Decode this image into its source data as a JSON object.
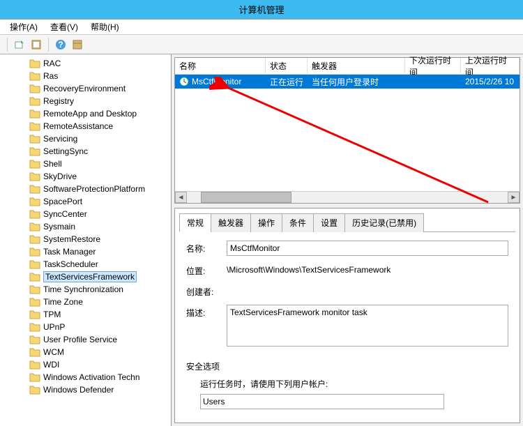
{
  "window": {
    "title": "计算机管理"
  },
  "menu": {
    "action": "操作(A)",
    "view": "查看(V)",
    "help": "帮助(H)"
  },
  "tree": {
    "items": [
      "RAC",
      "Ras",
      "RecoveryEnvironment",
      "Registry",
      "RemoteApp and Desktop",
      "RemoteAssistance",
      "Servicing",
      "SettingSync",
      "Shell",
      "SkyDrive",
      "SoftwareProtectionPlatform",
      "SpacePort",
      "SyncCenter",
      "Sysmain",
      "SystemRestore",
      "Task Manager",
      "TaskScheduler",
      "TextServicesFramework",
      "Time Synchronization",
      "Time Zone",
      "TPM",
      "UPnP",
      "User Profile Service",
      "WCM",
      "WDI",
      "Windows Activation Techn",
      "Windows Defender"
    ],
    "selected_index": 17
  },
  "task_list": {
    "headers": {
      "name": "名称",
      "status": "状态",
      "trigger": "触发器",
      "next_run": "下次运行时间",
      "last_run": "上次运行时间"
    },
    "row": {
      "name": "MsCtfMonitor",
      "status": "正在运行",
      "trigger": "当任何用户登录时",
      "next_run": "",
      "last_run": "2015/2/26 10"
    }
  },
  "tabs": {
    "general": "常规",
    "triggers": "触发器",
    "actions": "操作",
    "conditions": "条件",
    "settings": "设置",
    "history": "历史记录(已禁用)"
  },
  "details": {
    "labels": {
      "name": "名称:",
      "location": "位置:",
      "author": "创建者:",
      "description": "描述:",
      "security": "安全选项",
      "run_as": "运行任务时，请使用下列用户帐户:",
      "users": "Users"
    },
    "values": {
      "name": "MsCtfMonitor",
      "location": "\\Microsoft\\Windows\\TextServicesFramework",
      "author": "",
      "description": "TextServicesFramework monitor task"
    }
  }
}
